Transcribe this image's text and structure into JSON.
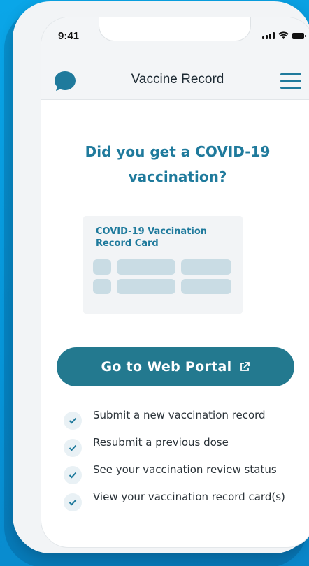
{
  "status_bar": {
    "time": "9:41"
  },
  "header": {
    "title": "Vaccine Record"
  },
  "main": {
    "headline": "Did you get a COVID-19 vaccination?",
    "card": {
      "title": "COVID-19 Vaccination Record Card"
    },
    "portal_button": {
      "label": "Go to Web Portal"
    },
    "features": [
      "Submit a new vaccination record",
      "Resubmit a previous dose",
      "See your vaccination review status",
      "View your vaccination record card(s)"
    ]
  },
  "colors": {
    "accent": "#1f7a9c",
    "button": "#23798f",
    "background": "#0aa6e8"
  },
  "icons": [
    "chat-icon",
    "menu-icon",
    "external-link-icon",
    "check-icon"
  ]
}
